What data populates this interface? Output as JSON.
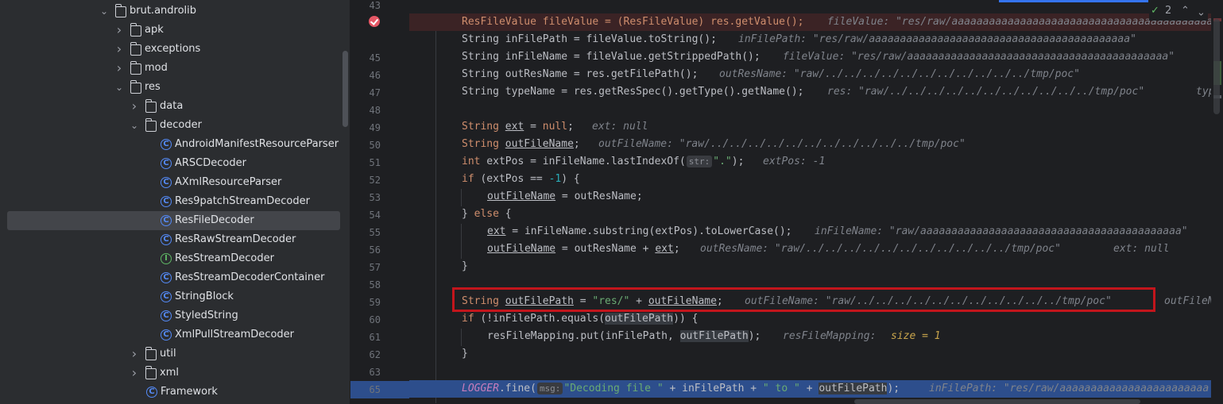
{
  "project_tree": {
    "items": [
      {
        "kind": "folder",
        "label": "brut.androlib",
        "expanded": true
      },
      {
        "kind": "folder",
        "label": "apk",
        "expanded": false
      },
      {
        "kind": "folder",
        "label": "exceptions",
        "expanded": false
      },
      {
        "kind": "folder",
        "label": "mod",
        "expanded": false
      },
      {
        "kind": "folder",
        "label": "res",
        "expanded": true
      },
      {
        "kind": "folder",
        "label": "data",
        "expanded": false
      },
      {
        "kind": "folder",
        "label": "decoder",
        "expanded": true
      },
      {
        "kind": "class",
        "label": "AndroidManifestResourceParser"
      },
      {
        "kind": "class",
        "label": "ARSCDecoder"
      },
      {
        "kind": "class",
        "label": "AXmlResourceParser"
      },
      {
        "kind": "class",
        "label": "Res9patchStreamDecoder"
      },
      {
        "kind": "class",
        "label": "ResFileDecoder",
        "selected": true
      },
      {
        "kind": "class",
        "label": "ResRawStreamDecoder"
      },
      {
        "kind": "interface",
        "label": "ResStreamDecoder"
      },
      {
        "kind": "class",
        "label": "ResStreamDecoderContainer"
      },
      {
        "kind": "class",
        "label": "StringBlock"
      },
      {
        "kind": "class",
        "label": "StyledString"
      },
      {
        "kind": "class",
        "label": "XmlPullStreamDecoder"
      },
      {
        "kind": "folder",
        "label": "util",
        "expanded": false
      },
      {
        "kind": "folder",
        "label": "xml",
        "expanded": false
      },
      {
        "kind": "class",
        "label": "Framework"
      }
    ]
  },
  "editor": {
    "inspection_count": "2",
    "gutter": [
      "43",
      "",
      "45",
      "46",
      "47",
      "48",
      "49",
      "50",
      "51",
      "52",
      "53",
      "54",
      "55",
      "56",
      "57",
      "58",
      "59",
      "60",
      "61",
      "62",
      "63",
      "64",
      "65"
    ],
    "lines": {
      "l44": {
        "code": "ResFileValue fileValue = (ResFileValue) res.getValue();",
        "hint": "fileValue: \"res/raw/aaaaaaaaaaaaaaaaaaaaaaaaaaaaaaaaaaaaaaaaaaaa"
      },
      "l45": {
        "code": "String inFilePath = fileValue.toString();",
        "hint": "inFilePath: \"res/raw/aaaaaaaaaaaaaaaaaaaaaaaaaaaaaaaaaaaaaaaaaa\""
      },
      "l46": {
        "code": "String inFileName = fileValue.getStrippedPath();",
        "hint": "fileValue: \"res/raw/aaaaaaaaaaaaaaaaaaaaaaaaaaaaaaaaaaaaaaaaaa\""
      },
      "l47": {
        "code": "String outResName = res.getFilePath();",
        "hint": "outResName: \"raw/../../../../../../../../../../../tmp/poc\""
      },
      "l48": {
        "code": "String typeName = res.getResSpec().getType().getName();",
        "hint": "res: \"raw/../../../../../../../../../../../tmp/poc\"",
        "hint2": "typ"
      },
      "l50": {
        "kw": "String",
        "var": "ext",
        "rest": " = ",
        "null": "null",
        ";": ";",
        "hint": "ext: null"
      },
      "l51": {
        "kw": "String",
        "var": "outFileName",
        ";": ";",
        "hint": "outFileName: \"raw/../../../../../../../../../../../tmp/poc\""
      },
      "l52": {
        "kw": "int",
        "pre": " extPos = inFileName.lastIndexOf(",
        "chip": "str:",
        "str": "\".\"",
        "post": ");",
        "hint": "extPos: -1"
      },
      "l53": {
        "kw": "if",
        "pre": " (extPos == ",
        "num": "-1",
        "post": ") {"
      },
      "l54": {
        "var": "outFileName",
        "post": " = outResName;"
      },
      "l55": {
        "pre": "} ",
        "kw": "else",
        "post": " {"
      },
      "l56": {
        "var": "ext",
        "post": " = inFileName.substring(extPos).toLowerCase();",
        "hint": "inFileName: \"raw/aaaaaaaaaaaaaaaaaaaaaaaaaaaaaaaaaaaaaaaaaa\""
      },
      "l57": {
        "var": "outFileName",
        "mid": " = outResName + ",
        "var2": "ext",
        ";": ";",
        "hint": "outResName: \"raw/../../../../../../../../../../../tmp/poc\"",
        "hint2": "ext: null"
      },
      "l58": {
        "code": "}"
      },
      "l60": {
        "kw": "String",
        "var": "outFilePath",
        "mid": " = ",
        "str": "\"res/\"",
        "mid2": " + ",
        "var2": "outFileName",
        ";": ";",
        "hint": "outFileName: \"raw/../../../../../../../../../../../tmp/poc\"",
        "hint2": "outFileN"
      },
      "l61": {
        "kw": "if",
        "pre": " (!inFilePath.equals(",
        "var": "outFilePath",
        "post": ")) {"
      },
      "l62": {
        "pre": "resFileMapping.put(inFilePath, ",
        "var": "outFilePath",
        "post": ");",
        "hint": "resFileMapping:",
        "hintnum": "size = 1"
      },
      "l63": {
        "code": "}"
      },
      "l65": {
        "logger": "LOGGER",
        "pre": ".fine(",
        "chip": "msg:",
        "str": "\"Decoding file \"",
        "mid": " + inFilePath + ",
        "str2": "\" to \"",
        "mid2": " + ",
        "var": "outFilePath",
        "post": ");",
        "hint": "inFilePath: \"res/raw/aaaaaaaaaaaaaaaaaaaaaaaa"
      }
    }
  },
  "colors": {
    "breakpoint": "#e55765",
    "highlight_box": "#c3151c",
    "exec_line": "#2d4e8c",
    "keyword": "#cf8e6d",
    "string": "#6aab73"
  }
}
